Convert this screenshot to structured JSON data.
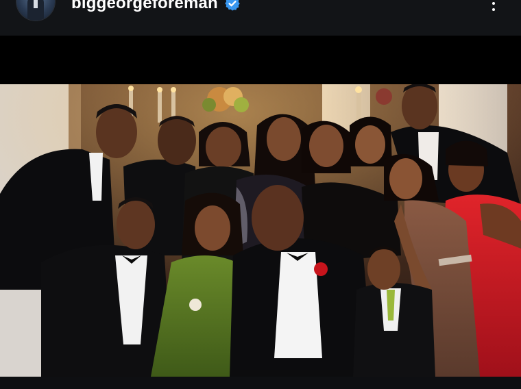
{
  "post": {
    "username": "biggeorgeforeman",
    "verified": true,
    "avatar_icon": "profile-avatar",
    "verified_icon": "verified-badge-icon",
    "more_icon": "more-options-icon",
    "accent_color": "#3897f0",
    "header_background": "#121417"
  },
  "photo": {
    "subject": "family group photo"
  }
}
